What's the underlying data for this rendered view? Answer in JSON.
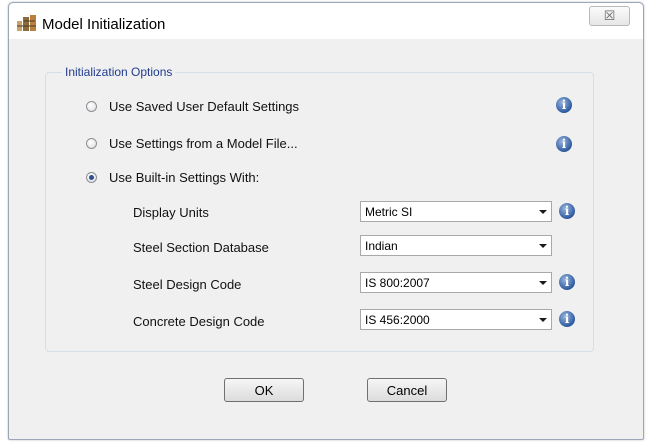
{
  "window": {
    "title": "Model Initialization",
    "close_glyph": "☒",
    "app_icon": "etabs-app-icon"
  },
  "group": {
    "legend": "Initialization Options"
  },
  "options": [
    {
      "label": "Use Saved User Default Settings",
      "checked": false
    },
    {
      "label": "Use Settings from a Model File...",
      "checked": false
    },
    {
      "label": "Use Built-in Settings With:",
      "checked": true
    }
  ],
  "info_glyph": "i",
  "fields": {
    "display_units": {
      "label": "Display Units",
      "value": "Metric SI"
    },
    "steel_section_database": {
      "label": "Steel Section Database",
      "value": "Indian"
    },
    "steel_design_code": {
      "label": "Steel Design Code",
      "value": "IS 800:2007"
    },
    "concrete_design_code": {
      "label": "Concrete Design Code",
      "value": "IS 456:2000"
    }
  },
  "buttons": {
    "ok": "OK",
    "cancel": "Cancel"
  },
  "colors": {
    "legend_text": "#1f3c8f",
    "info_icon": "#2d5aa0",
    "dialog_bg": "#f0f0f0"
  }
}
